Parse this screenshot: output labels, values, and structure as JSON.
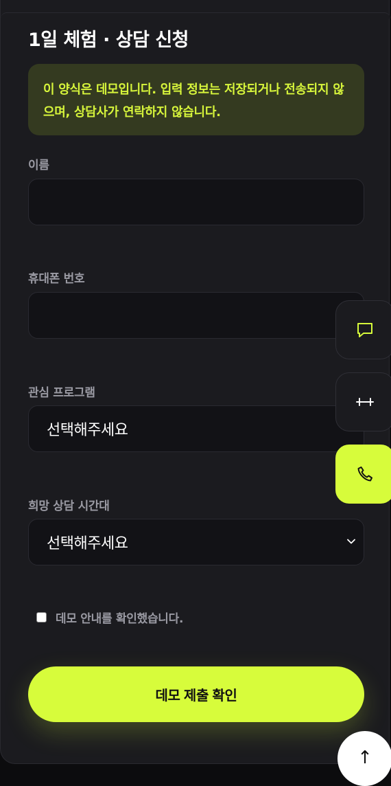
{
  "form": {
    "title": "1일 체험 · 상담 신청",
    "notice": "이 양식은 데모입니다. 입력 정보는 저장되거나 전송되지 않으며, 상담사가 연락하지 않습니다.",
    "fields": {
      "name": {
        "label": "이름",
        "value": ""
      },
      "phone": {
        "label": "휴대폰 번호",
        "value": ""
      },
      "program": {
        "label": "관심 프로그램",
        "selected": "선택해주세요"
      },
      "time": {
        "label": "희망 상담 시간대",
        "selected": "선택해주세요"
      }
    },
    "agree_label": "데모 안내를 확인했습니다.",
    "agree_checked": false,
    "submit_label": "데모 제출 확인"
  },
  "floating_buttons": [
    {
      "icon": "chat-icon"
    },
    {
      "icon": "dumbbell-icon"
    },
    {
      "icon": "phone-icon"
    }
  ],
  "scroll_top": {
    "icon": "arrow-up-icon",
    "label": "↑"
  },
  "colors": {
    "accent": "#d7fc3b",
    "notice_bg": "#343a20",
    "card_bg": "#1b1b1f",
    "field_bg": "#121216",
    "label": "#9a9aa3"
  }
}
